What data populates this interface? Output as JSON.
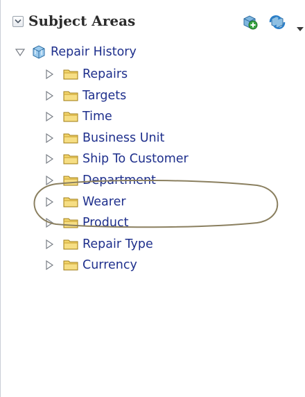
{
  "header": {
    "title": "Subject Areas",
    "icons": [
      "collapse-toggle-icon",
      "add-subject-area-icon",
      "refresh-icon",
      "dropdown-caret-icon"
    ]
  },
  "tree": {
    "root": {
      "label": "Repair History",
      "expanded": true,
      "icon": "subject-area-cube-icon"
    },
    "folders": [
      {
        "label": "Repairs"
      },
      {
        "label": "Targets"
      },
      {
        "label": "Time"
      },
      {
        "label": "Business Unit"
      },
      {
        "label": "Ship To Customer"
      },
      {
        "label": "Department"
      },
      {
        "label": "Wearer"
      },
      {
        "label": "Product"
      },
      {
        "label": "Repair Type"
      },
      {
        "label": "Currency"
      }
    ]
  },
  "colors": {
    "link_text": "#1e2f8c",
    "folder": "#e8c24a",
    "highlight_ellipse": "#8a7f5f"
  }
}
